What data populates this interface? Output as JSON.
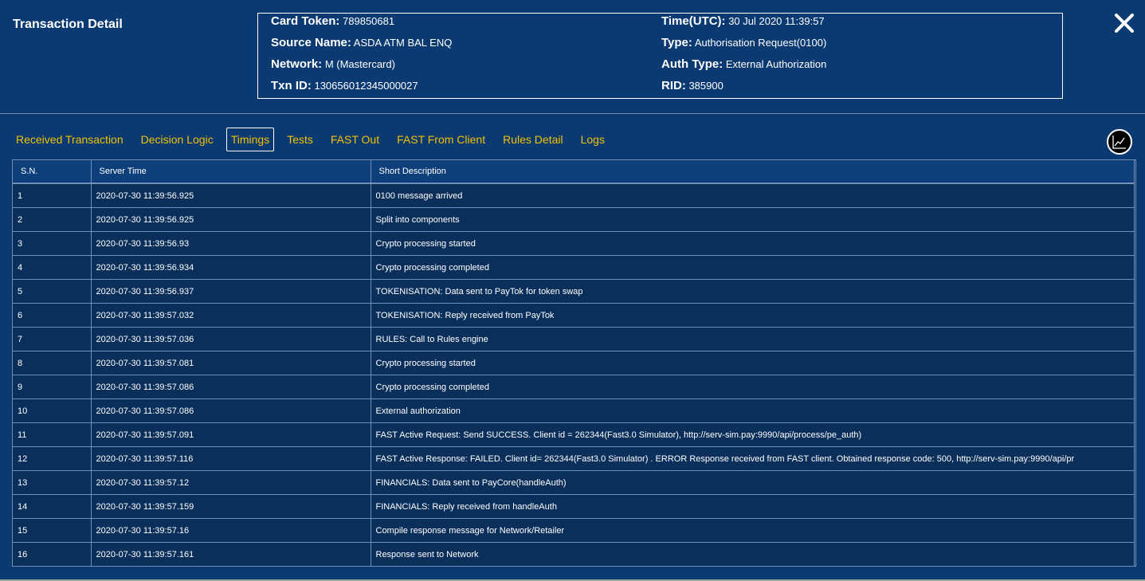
{
  "header": {
    "title": "Transaction Detail",
    "info": {
      "card_token_label": "Card Token:",
      "card_token": "789850681",
      "source_name_label": "Source Name:",
      "source_name": "ASDA ATM BAL ENQ",
      "network_label": "Network:",
      "network": "M (Mastercard)",
      "txn_id_label": "Txn ID:",
      "txn_id": "130656012345000027",
      "time_label": "Time(UTC):",
      "time": "30 Jul 2020 11:39:57",
      "type_label": "Type:",
      "type": "Authorisation Request(0100)",
      "auth_type_label": "Auth Type:",
      "auth_type": "External Authorization",
      "rid_label": "RID:",
      "rid": "385900"
    }
  },
  "tabs": [
    {
      "label": "Received Transaction"
    },
    {
      "label": "Decision Logic"
    },
    {
      "label": "Timings"
    },
    {
      "label": "Tests"
    },
    {
      "label": "FAST Out"
    },
    {
      "label": "FAST From Client"
    },
    {
      "label": "Rules Detail"
    },
    {
      "label": "Logs"
    }
  ],
  "active_tab": "Timings",
  "table": {
    "columns": [
      "S.N.",
      "Server Time",
      "Short Description"
    ],
    "rows": [
      {
        "sn": "1",
        "time": "2020-07-30 11:39:56.925",
        "desc": "0100 message arrived"
      },
      {
        "sn": "2",
        "time": "2020-07-30 11:39:56.925",
        "desc": "Split into components"
      },
      {
        "sn": "3",
        "time": "2020-07-30 11:39:56.93",
        "desc": "Crypto processing started"
      },
      {
        "sn": "4",
        "time": "2020-07-30 11:39:56.934",
        "desc": "Crypto processing completed"
      },
      {
        "sn": "5",
        "time": "2020-07-30 11:39:56.937",
        "desc": "TOKENISATION: Data sent to PayTok for token swap"
      },
      {
        "sn": "6",
        "time": "2020-07-30 11:39:57.032",
        "desc": "TOKENISATION: Reply received from PayTok"
      },
      {
        "sn": "7",
        "time": "2020-07-30 11:39:57.036",
        "desc": "RULES: Call to Rules engine"
      },
      {
        "sn": "8",
        "time": "2020-07-30 11:39:57.081",
        "desc": "Crypto processing started"
      },
      {
        "sn": "9",
        "time": "2020-07-30 11:39:57.086",
        "desc": "Crypto processing completed"
      },
      {
        "sn": "10",
        "time": "2020-07-30 11:39:57.086",
        "desc": "External authorization"
      },
      {
        "sn": "11",
        "time": "2020-07-30 11:39:57.091",
        "desc": "FAST Active Request: Send SUCCESS. Client id = 262344(Fast3.0 Simulator), http://serv-sim.pay:9990/api/process/pe_auth)"
      },
      {
        "sn": "12",
        "time": "2020-07-30 11:39:57.116",
        "desc": "FAST Active Response: FAILED. Client id= 262344(Fast3.0 Simulator) . ERROR Response received from FAST client. Obtained response code: 500, http://serv-sim.pay:9990/api/pr"
      },
      {
        "sn": "13",
        "time": "2020-07-30 11:39:57.12",
        "desc": "FINANCIALS: Data sent to PayCore(handleAuth)"
      },
      {
        "sn": "14",
        "time": "2020-07-30 11:39:57.159",
        "desc": "FINANCIALS: Reply received from handleAuth"
      },
      {
        "sn": "15",
        "time": "2020-07-30 11:39:57.16",
        "desc": "Compile response message for Network/Retailer"
      },
      {
        "sn": "16",
        "time": "2020-07-30 11:39:57.161",
        "desc": "Response sent to Network"
      }
    ]
  },
  "colors": {
    "background": "#0b3a72",
    "tab_text": "#f2c200",
    "row_background": "#0a2f5a",
    "border": "#6f8fb8"
  },
  "icons": {
    "close": "close-x-icon",
    "chart": "line-chart-icon"
  }
}
